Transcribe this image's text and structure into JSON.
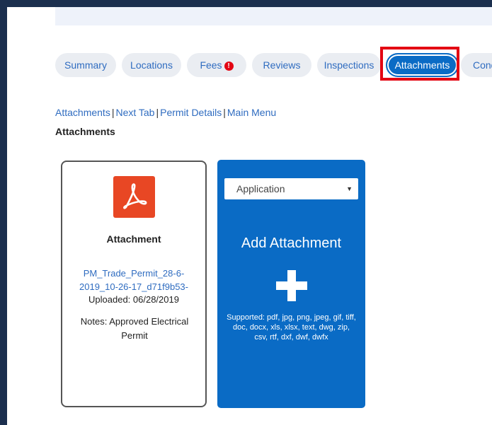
{
  "tabs": [
    {
      "label": "Summary"
    },
    {
      "label": "Locations"
    },
    {
      "label": "Fees"
    },
    {
      "label": "Reviews"
    },
    {
      "label": "Inspections"
    },
    {
      "label": "Attachments"
    },
    {
      "label": "Conditions"
    }
  ],
  "fees_alert": "!",
  "breadcrumb": [
    "Attachments",
    "Next Tab",
    "Permit Details",
    "Main Menu"
  ],
  "section_title": "Attachments",
  "attachment_card": {
    "title": "Attachment",
    "file_name": "PM_Trade_Permit_28-6-2019_10-26-17_d71f9b53-",
    "uploaded": "Uploaded: 06/28/2019",
    "notes": "Notes: Approved Electrical Permit"
  },
  "add_panel": {
    "select_value": "Application",
    "title": "Add Attachment",
    "supported": "Supported: pdf, jpg, png, jpeg, gif, tiff, doc, docx, xls, xlsx, text, dwg, zip, csv, rtf, dxf, dwf, dwfx"
  },
  "colors": {
    "accent": "#0a6bc5",
    "highlight": "#e30613",
    "pdf": "#e84724"
  }
}
